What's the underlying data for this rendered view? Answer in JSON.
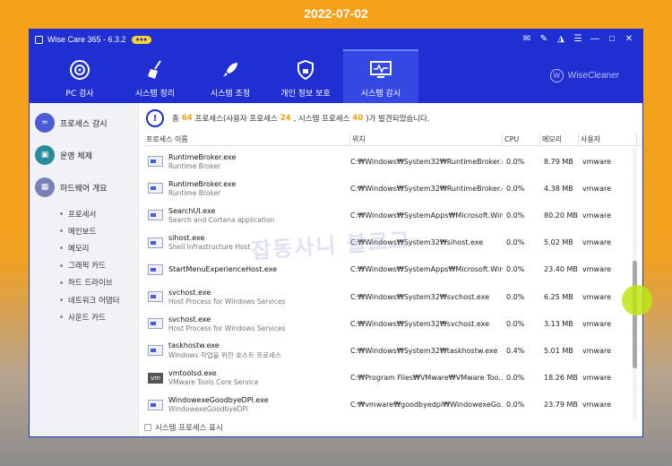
{
  "date_banner": "2022-07-02",
  "window": {
    "title": "Wise Care 365 - 6.3.2",
    "controls": [
      "message-icon",
      "edit-icon",
      "shirt-icon",
      "menu-icon",
      "minimize-icon",
      "maximize-icon",
      "close-icon"
    ]
  },
  "nav": {
    "items": [
      {
        "label": "PC 검사",
        "icon": "target-icon"
      },
      {
        "label": "시스템 정리",
        "icon": "broom-icon"
      },
      {
        "label": "시스템 조정",
        "icon": "rocket-icon"
      },
      {
        "label": "개인 정보 보호",
        "icon": "shield-lock-icon"
      },
      {
        "label": "시스템 감시",
        "icon": "monitor-icon",
        "active": true
      }
    ],
    "brand": "WiseCleaner"
  },
  "sidebar": {
    "items": [
      {
        "label": "프로세스 감시",
        "icon": "process-monitor-icon"
      },
      {
        "label": "운영 체제",
        "icon": "os-icon"
      },
      {
        "label": "하드웨어 개요",
        "icon": "hardware-icon"
      }
    ],
    "sub_items": [
      "프로세서",
      "메인보드",
      "메모리",
      "그래픽 카드",
      "하드 드라이브",
      "네트워크 어댑터",
      "사운드 카드"
    ]
  },
  "summary": {
    "prefix": "총",
    "total": "64",
    "middle1": "프로세스(사용자 프로세스",
    "user": "24",
    "middle2": ", 시스템 프로세스",
    "system": "40",
    "suffix": ")가 발견되었습니다."
  },
  "table": {
    "columns": [
      "프로세스 이름",
      "위치",
      "CPU",
      "메모리",
      "사용자"
    ],
    "rows": [
      {
        "name": "RuntimeBroker.exe",
        "desc": "Runtime Broker",
        "location": "C:₩Windows₩System32₩RuntimeBroker.e...",
        "cpu": "0.0%",
        "memory": "8.79 MB",
        "user": "vmware",
        "icon": "window-icon"
      },
      {
        "name": "RuntimeBroker.exe",
        "desc": "Runtime Broker",
        "location": "C:₩Windows₩System32₩RuntimeBroker.e...",
        "cpu": "0.0%",
        "memory": "4.38 MB",
        "user": "vmware",
        "icon": "window-icon"
      },
      {
        "name": "SearchUI.exe",
        "desc": "Search and Cortana application",
        "location": "C:₩Windows₩SystemApps₩Microsoft.Win...",
        "cpu": "0.0%",
        "memory": "80.20 MB",
        "user": "vmware",
        "icon": "window-icon"
      },
      {
        "name": "sihost.exe",
        "desc": "Shell Infrastructure Host",
        "location": "C:₩Windows₩System32₩sihost.exe",
        "cpu": "0.0%",
        "memory": "5.02 MB",
        "user": "vmware",
        "icon": "window-icon"
      },
      {
        "name": "StartMenuExperienceHost.exe",
        "desc": "",
        "location": "C:₩Windows₩SystemApps₩Microsoft.Win...",
        "cpu": "0.0%",
        "memory": "23.40 MB",
        "user": "vmware",
        "icon": "window-icon"
      },
      {
        "name": "svchost.exe",
        "desc": "Host Process for Windows Services",
        "location": "C:₩Windows₩System32₩svchost.exe",
        "cpu": "0.0%",
        "memory": "6.25 MB",
        "user": "vmware",
        "icon": "window-icon"
      },
      {
        "name": "svchost.exe",
        "desc": "Host Process for Windows Services",
        "location": "C:₩Windows₩System32₩svchost.exe",
        "cpu": "0.0%",
        "memory": "3.13 MB",
        "user": "vmware",
        "icon": "window-icon"
      },
      {
        "name": "taskhostw.exe",
        "desc": "Windows 작업을 위한 호스트 프로세스",
        "location": "C:₩Windows₩System32₩taskhostw.exe",
        "cpu": "0.4%",
        "memory": "5.01 MB",
        "user": "vmware",
        "icon": "window-icon"
      },
      {
        "name": "vmtoolsd.exe",
        "desc": "VMware Tools Core Service",
        "location": "C:₩Program Files₩VMware₩VMware Too...",
        "cpu": "0.0%",
        "memory": "18.26 MB",
        "user": "vmware",
        "icon": "vmware-icon"
      },
      {
        "name": "WindowexeGoodbyeDPI.exe",
        "desc": "WindowexeGoodbyeDPI",
        "location": "C:₩vmware₩goodbyedpi₩WindowexeGo...",
        "cpu": "0.0%",
        "memory": "23.79 MB",
        "user": "vmware",
        "icon": "window-icon"
      }
    ]
  },
  "footer": {
    "checkbox_label": "시스템 프로세스 표시"
  },
  "watermark": "잡동사니 블로그"
}
